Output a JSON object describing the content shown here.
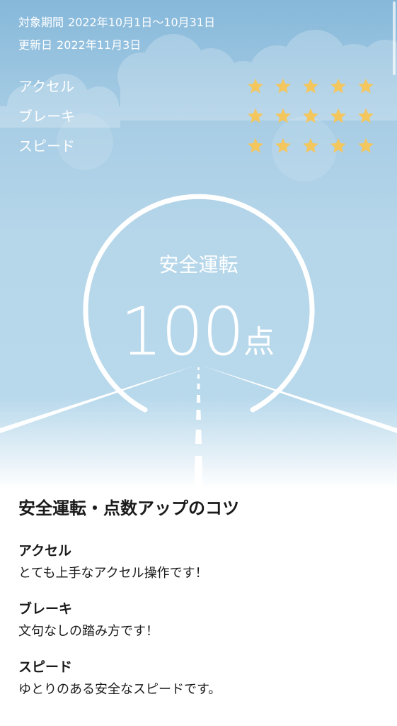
{
  "period": {
    "target_label": "対象期間",
    "target_value": "2022年10月1日〜10月31日",
    "updated_label": "更新日",
    "updated_value": "2022年11月3日"
  },
  "ratings": [
    {
      "label": "アクセル",
      "stars": 5,
      "max": 5
    },
    {
      "label": "ブレーキ",
      "stars": 5,
      "max": 5
    },
    {
      "label": "スピード",
      "stars": 5,
      "max": 5
    }
  ],
  "score": {
    "title": "安全運転",
    "value": "100",
    "unit": "点",
    "gauge_fraction": 1.0
  },
  "tips": {
    "title": "安全運転・点数アップのコツ",
    "items": [
      {
        "heading": "アクセル",
        "body": "とても上手なアクセル操作です！"
      },
      {
        "heading": "ブレーキ",
        "body": "文句なしの踏み方です！"
      },
      {
        "heading": "スピード",
        "body": "ゆとりのある安全なスピードです。"
      }
    ]
  },
  "colors": {
    "star": "#f3c65e",
    "sky_top": "#86b8da",
    "sky_mid": "#b6d6ea",
    "text_white": "#ffffff",
    "text_dark": "#1a1a1a"
  },
  "icons": {
    "star": "star-icon"
  }
}
